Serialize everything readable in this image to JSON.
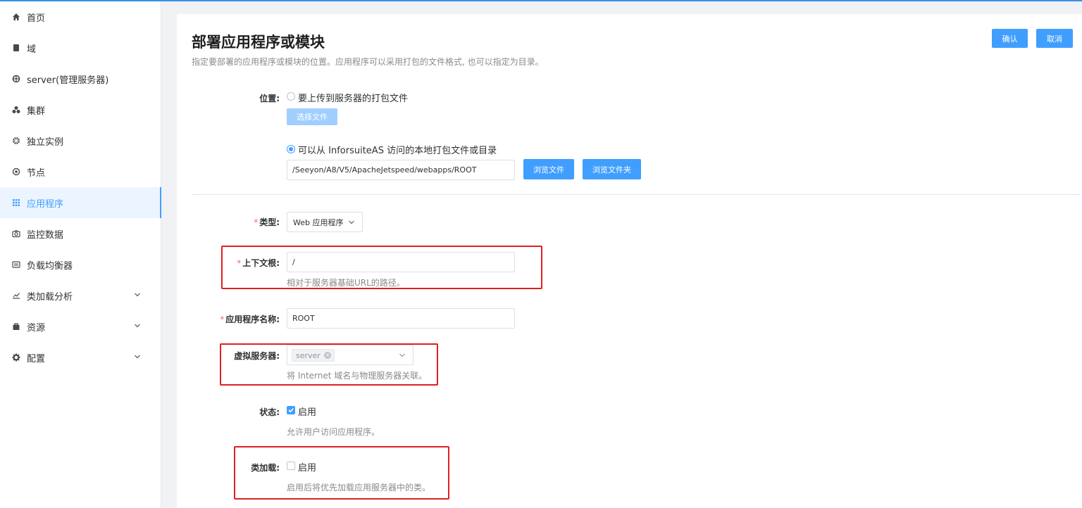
{
  "sidebar": {
    "items": [
      {
        "label": "首页",
        "icon": "home-icon"
      },
      {
        "label": "域",
        "icon": "book-icon"
      },
      {
        "label": "server(管理服务器)",
        "icon": "globe-icon"
      },
      {
        "label": "集群",
        "icon": "cluster-icon"
      },
      {
        "label": "独立实例",
        "icon": "instance-icon"
      },
      {
        "label": "节点",
        "icon": "node-icon"
      },
      {
        "label": "应用程序",
        "icon": "grid-icon",
        "active": true
      },
      {
        "label": "监控数据",
        "icon": "camera-icon"
      },
      {
        "label": "负载均衡器",
        "icon": "balancer-icon"
      },
      {
        "label": "类加载分析",
        "icon": "chart-icon",
        "expandable": true
      },
      {
        "label": "资源",
        "icon": "bag-icon",
        "expandable": true
      },
      {
        "label": "配置",
        "icon": "gear-icon",
        "expandable": true
      }
    ]
  },
  "header": {
    "title": "部署应用程序或模块",
    "subtitle": "指定要部署的应用程序或模块的位置。应用程序可以采用打包的文件格式, 也可以指定为目录。",
    "confirm_label": "确认",
    "cancel_label": "取消"
  },
  "form": {
    "location": {
      "label": "位置:",
      "option_upload": "要上传到服务器的打包文件",
      "choose_file_label": "选择文件",
      "option_local": "可以从 InforsuiteAS 访问的本地打包文件或目录",
      "path_value": "/Seeyon/A8/V5/ApacheJetspeed/webapps/ROOT",
      "browse_file_label": "浏览文件",
      "browse_folder_label": "浏览文件夹",
      "selected_option": "local"
    },
    "type": {
      "required_mark": "*",
      "label": "类型:",
      "value": "Web 应用程序"
    },
    "context_root": {
      "required_mark": "*",
      "label": "上下文根:",
      "value": "/",
      "hint": "相对于服务器基础URL的路径。"
    },
    "app_name": {
      "required_mark": "*",
      "label": "应用程序名称:",
      "value": "ROOT"
    },
    "virtual_server": {
      "label": "虚拟服务器:",
      "tag": "server",
      "hint": "将 Internet 域名与物理服务器关联。"
    },
    "status": {
      "label": "状态:",
      "checkbox_label": "启用",
      "checked": true,
      "hint": "允许用户访问应用程序。"
    },
    "class_loading": {
      "label": "类加载:",
      "checkbox_label": "启用",
      "checked": false,
      "hint": "启用后将优先加载应用服务器中的类。"
    }
  },
  "colors": {
    "primary": "#409eff",
    "annotation_red": "#e02020",
    "required": "#f56c6c"
  }
}
